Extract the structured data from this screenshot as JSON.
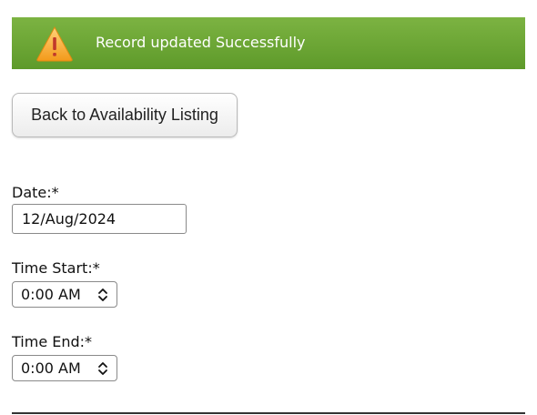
{
  "alert": {
    "message": "Record updated Successfully",
    "icon": "warning-triangle-icon",
    "background_color": "#6aa533"
  },
  "back_button": {
    "label": "Back to Availability Listing"
  },
  "form": {
    "date": {
      "label": "Date:*",
      "value": "12/Aug/2024"
    },
    "time_start": {
      "label": "Time Start:*",
      "value": "0:00 AM",
      "icon": "chevron-up-down-icon"
    },
    "time_end": {
      "label": "Time End:*",
      "value": "0:00 AM",
      "icon": "chevron-up-down-icon"
    }
  }
}
